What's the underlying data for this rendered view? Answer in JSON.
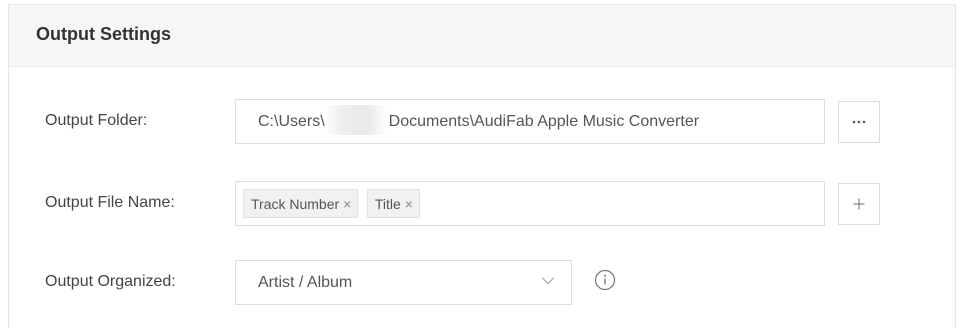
{
  "panel": {
    "title": "Output Settings"
  },
  "output_folder": {
    "label": "Output Folder:",
    "value_prefix": "C:\\Users\\",
    "value_suffix": "Documents\\AudiFab Apple Music Converter",
    "browse_icon": "ellipsis-icon"
  },
  "output_file_name": {
    "label": "Output File Name:",
    "tags": [
      {
        "label": "Track Number",
        "remove_icon": "close-icon"
      },
      {
        "label": "Title",
        "remove_icon": "close-icon"
      }
    ],
    "add_icon": "plus-icon"
  },
  "output_organized": {
    "label": "Output Organized:",
    "selected": "Artist / Album",
    "dropdown_icon": "chevron-down-icon",
    "info_icon": "info-icon"
  },
  "colors": {
    "header_bg": "#f6f6f6",
    "border": "#dcdcdc",
    "text": "#444444",
    "tag_bg": "#f1f1f1"
  }
}
